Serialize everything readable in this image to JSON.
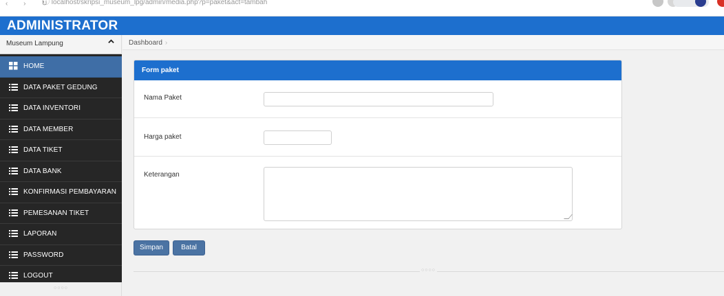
{
  "header": {
    "brand": "ADMINISTRATOR"
  },
  "sidebar": {
    "site_select": "Museum Lampung",
    "items": [
      {
        "label": "HOME",
        "icon": "grid-icon",
        "active": true
      },
      {
        "label": "DATA PAKET GEDUNG",
        "icon": "list-icon"
      },
      {
        "label": "DATA INVENTORI",
        "icon": "list-icon"
      },
      {
        "label": "DATA MEMBER",
        "icon": "list-icon"
      },
      {
        "label": "DATA TIKET",
        "icon": "list-icon"
      },
      {
        "label": "DATA BANK",
        "icon": "list-icon"
      },
      {
        "label": "KONFIRMASI PEMBAYARAN",
        "icon": "list-icon"
      },
      {
        "label": "PEMESANAN TIKET",
        "icon": "list-icon"
      },
      {
        "label": "LAPORAN",
        "icon": "list-icon"
      },
      {
        "label": "PASSWORD",
        "icon": "list-icon"
      },
      {
        "label": "LOGOUT",
        "icon": "list-icon"
      }
    ]
  },
  "breadcrumb": {
    "items": [
      "Dashboard"
    ]
  },
  "form": {
    "title": "Form paket",
    "fields": {
      "nama_paket": {
        "label": "Nama Paket",
        "value": ""
      },
      "harga_paket": {
        "label": "Harga paket",
        "value": ""
      },
      "keterangan": {
        "label": "Keterangan",
        "value": ""
      }
    },
    "save_label": "Simpan",
    "cancel_label": "Batal"
  },
  "colors": {
    "header_blue": "#1d6fce",
    "sidebar_bg": "#262626",
    "active_item": "#3f6ea6",
    "button": "#4b73a3"
  }
}
